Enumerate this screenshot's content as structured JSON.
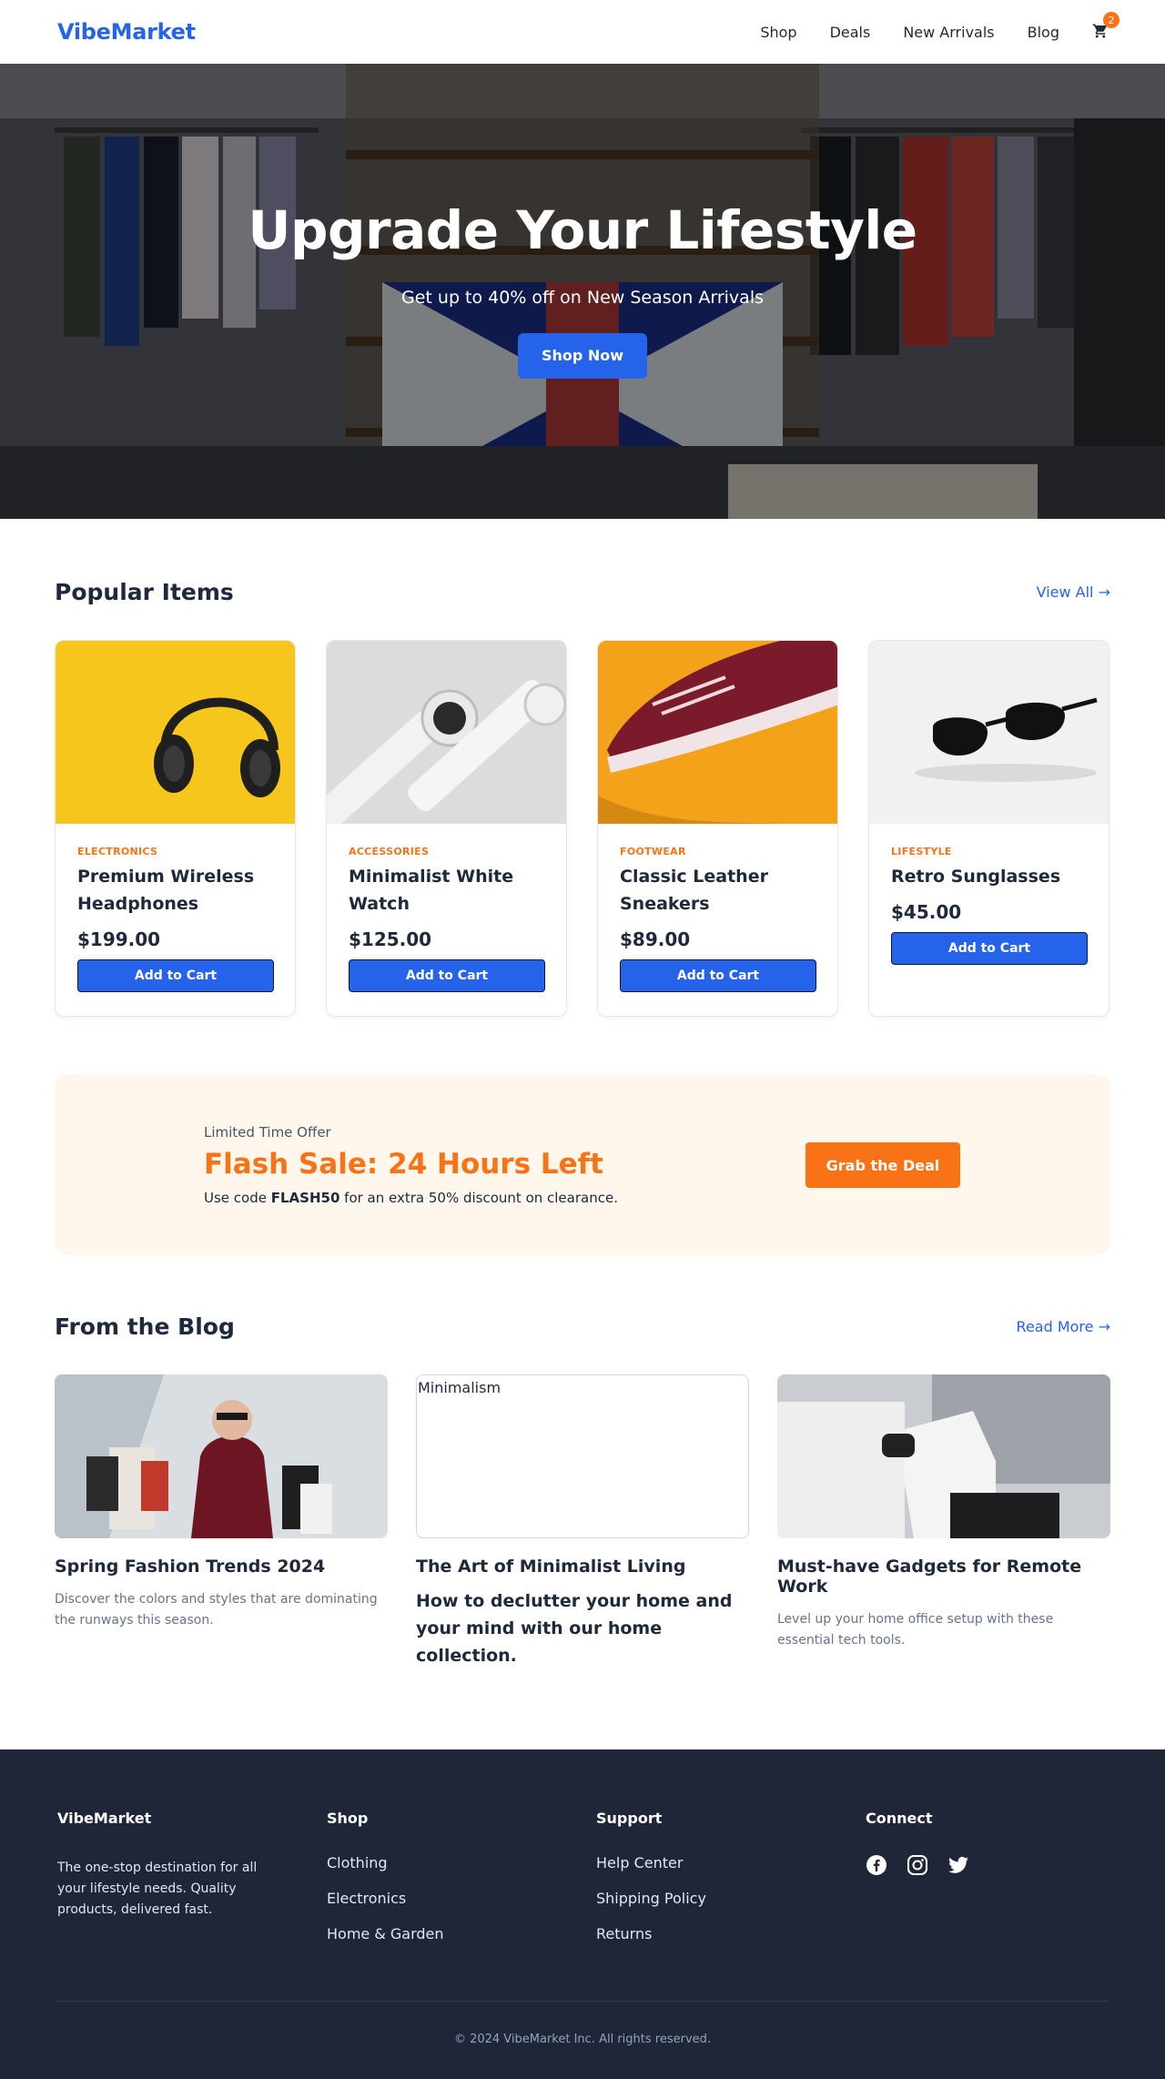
{
  "nav": {
    "logo": "VibeMarket",
    "links": [
      "Shop",
      "Deals",
      "New Arrivals",
      "Blog"
    ],
    "cart_count": "2",
    "cart_icon": "cart-icon"
  },
  "hero": {
    "title": "Upgrade Your Lifestyle",
    "subtitle": "Get up to 40% off on New Season Arrivals",
    "cta": "Shop Now"
  },
  "popular": {
    "title": "Popular Items",
    "view_all": "View All →",
    "products": [
      {
        "category": "ELECTRONICS",
        "name": "Premium Wireless Headphones",
        "price": "$199.00",
        "button": "Add to Cart"
      },
      {
        "category": "ACCESSORIES",
        "name": "Minimalist White Watch",
        "price": "$125.00",
        "button": "Add to Cart"
      },
      {
        "category": "FOOTWEAR",
        "name": "Classic Leather Sneakers",
        "price": "$89.00",
        "button": "Add to Cart"
      },
      {
        "category": "LIFESTYLE",
        "name": "Retro Sunglasses",
        "price": "$45.00",
        "button": "Add to Cart"
      }
    ]
  },
  "flash": {
    "kicker": "Limited Time Offer",
    "title": "Flash Sale: 24 Hours Left",
    "text_before": "Use code ",
    "code": "FLASH50",
    "text_after": " for an extra 50% discount on clearance.",
    "button": "Grab the Deal"
  },
  "blog": {
    "title": "From the Blog",
    "read_more": "Read More →",
    "posts": [
      {
        "title": "Spring Fashion Trends 2024",
        "desc": "Discover the colors and styles that are dominating the runways this season."
      },
      {
        "title": "The Art of Minimalist Living",
        "desc": "How to declutter your home and your mind with our home collection.",
        "broken_alt": "Minimalism"
      },
      {
        "title": "Must-have Gadgets for Remote Work",
        "desc": "Level up your home office setup with these essential tech tools."
      }
    ]
  },
  "footer": {
    "brand": "VibeMarket",
    "about": "The one-stop destination for all your lifestyle needs. Quality products, delivered fast.",
    "shop_title": "Shop",
    "shop_links": [
      "Clothing",
      "Electronics",
      "Home & Garden"
    ],
    "support_title": "Support",
    "support_links": [
      "Help Center",
      "Shipping Policy",
      "Returns"
    ],
    "connect_title": "Connect",
    "socials": [
      "facebook-icon",
      "instagram-icon",
      "twitter-icon"
    ],
    "copyright": "© 2024 VibeMarket Inc. All rights reserved."
  },
  "colors": {
    "primary": "#2563eb",
    "accent": "#f97316",
    "footer_bg": "#1e2638",
    "flash_bg": "#fff6ec"
  }
}
